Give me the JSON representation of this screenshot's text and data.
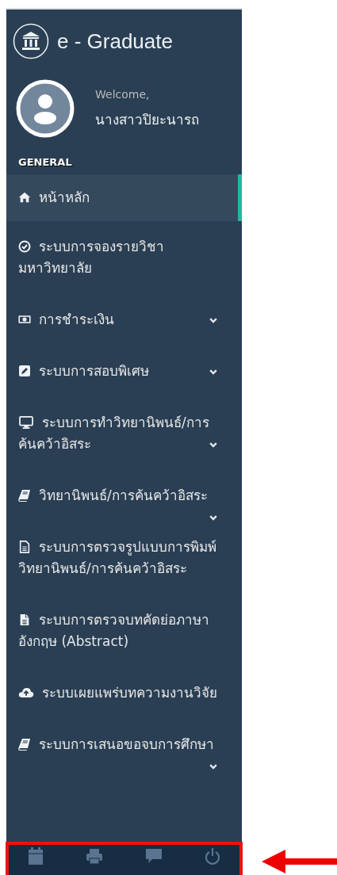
{
  "app": {
    "title": "e - Graduate"
  },
  "profile": {
    "greeting": "Welcome,",
    "name": "นางสาวปิยะนารถ"
  },
  "menu_section": "GENERAL",
  "menu": [
    {
      "kind": "home",
      "label": "หน้าหลัก",
      "selected": true,
      "expandable": false
    },
    {
      "kind": "check",
      "label": "ระบบการจองรายวิชามหาวิทยาลัย",
      "selected": false,
      "expandable": false
    },
    {
      "kind": "money",
      "label": "การชำระเงิน",
      "selected": false,
      "expandable": true
    },
    {
      "kind": "edit",
      "label": "ระบบการสอบพิเศษ",
      "selected": false,
      "expandable": true
    },
    {
      "kind": "monitor",
      "label": "ระบบการทำวิทยานิพนธ์/การค้นคว้าอิสระ",
      "selected": false,
      "expandable": true
    },
    {
      "kind": "book",
      "label": "วิทยานิพนธ์/การค้นคว้าอิสระ",
      "selected": false,
      "expandable": true
    },
    {
      "kind": "file-lines",
      "label": "ระบบการตรวจรูปแบบการพิมพ์วิทยานิพนธ์/การค้นคว้าอิสระ",
      "selected": false,
      "expandable": false
    },
    {
      "kind": "file",
      "label": "ระบบการตรวจบทคัดย่อภาษาอังกฤษ (Abstract)",
      "selected": false,
      "expandable": false
    },
    {
      "kind": "cloud",
      "label": "ระบบเผยแพร่บทความงานวิจัย",
      "selected": false,
      "expandable": false
    },
    {
      "kind": "book",
      "label": "ระบบการเสนอขอจบการศึกษา",
      "selected": false,
      "expandable": true
    }
  ],
  "footer_buttons": [
    {
      "kind": "calendar"
    },
    {
      "kind": "print"
    },
    {
      "kind": "chat"
    },
    {
      "kind": "power"
    }
  ],
  "annotations": {
    "highlight_frame": true,
    "pointer_arrow": true
  }
}
